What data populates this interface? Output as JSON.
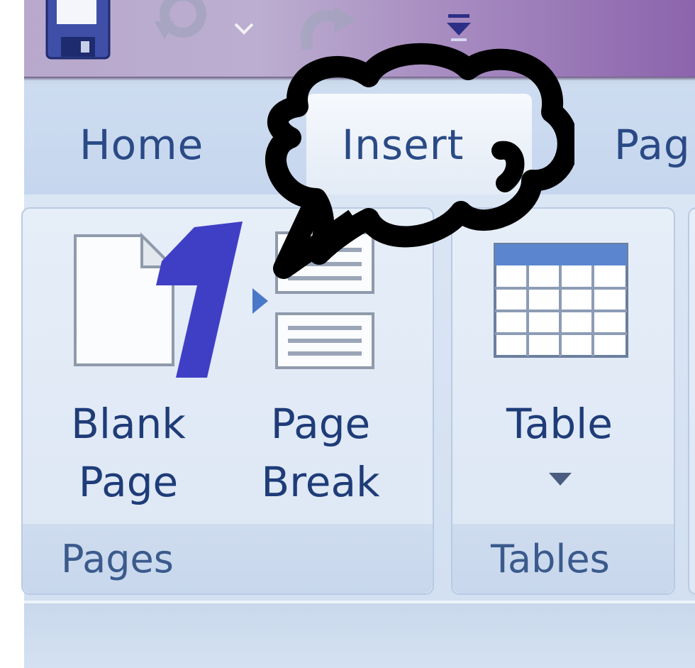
{
  "tabs": {
    "home": "Home",
    "insert": "Insert",
    "page_layout": "Pag"
  },
  "groups": {
    "pages": {
      "label": "Pages",
      "blank_page": {
        "line1": "Blank",
        "line2": "Page"
      },
      "page_break": {
        "line1": "Page",
        "line2": "Break"
      }
    },
    "tables": {
      "label": "Tables",
      "table": {
        "label": "Table"
      }
    }
  },
  "annotation": {
    "step_number": "1"
  },
  "colors": {
    "tab_text": "#2a4a86",
    "label_text": "#1e3c78",
    "group_label": "#3b5a8c",
    "step_number": "#3f3fc6",
    "annotation_stroke": "#000000",
    "title_bar": "#8c64ad"
  },
  "icons": {
    "save": "save-icon",
    "undo": "undo-icon",
    "redo": "redo-icon",
    "customize": "customize-toolbar-icon",
    "blank_page": "blank-page-icon",
    "page_break": "page-break-icon",
    "table": "table-icon",
    "dropdown": "chevron-down-icon"
  }
}
